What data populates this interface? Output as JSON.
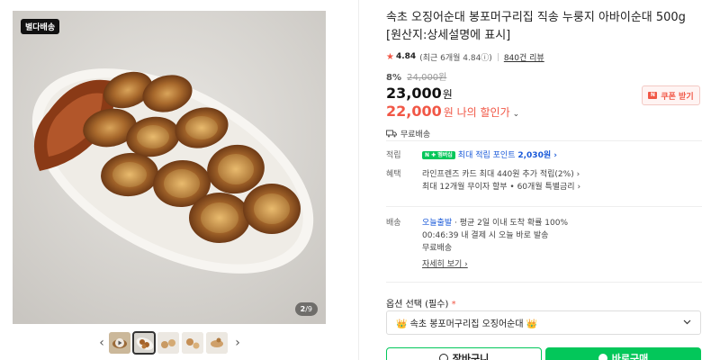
{
  "gallery": {
    "tag": "별다배송",
    "counter_current": "2",
    "counter_sep": "/9",
    "prev_arrow": "‹",
    "next_arrow": "›"
  },
  "product": {
    "title": "속초 오징어순대 봉포머구리집 직송 누룽지 아바이순대 500g [원산지:상세설명에 표시]",
    "rating": "4.84",
    "rating_detail": "(최근 6개월 4.84ⓘ)",
    "reviews": "840건 리뷰",
    "discount_rate": "8%",
    "original_price": "24,000원",
    "price": "23,000",
    "price_unit": "원",
    "my_price": "22,000",
    "my_price_label": "원 나의 할인가",
    "my_price_chevron": "⌄",
    "coupon_label": "쿠폰 받기",
    "shipping_free": "무료배송"
  },
  "benefits": {
    "points_key": "적립",
    "points_badge": "N ✚ 멤버십",
    "points_text": "최대 적립 포인트",
    "points_value": "2,030원 ›",
    "benefit_key": "혜택",
    "benefit_line1": "라인프렌즈 카드 최대 440원 추가 적립(2%) ›",
    "benefit_line2": "최대 12개월 무이자 할부 • 60개월 특별금리 ›"
  },
  "delivery": {
    "key": "배송",
    "today_label": "오늘출발",
    "today_desc": "· 평균 2일 이내 도착 확률 100%",
    "cutoff": "00:46:39  내 결제 시 오늘 바로 발송",
    "fee": "무료배송",
    "detail_link": "자세히 보기 ›"
  },
  "options": {
    "label": "옵션 선택 (필수)",
    "required_mark": "*",
    "selected": "👑 속초 봉포머구리집 오징어순대 👑"
  },
  "actions": {
    "cart_label": "장바구니",
    "buy_label": "바로구매"
  },
  "colors": {
    "accent_red": "#f15746",
    "naver_green": "#03c75a",
    "link_blue": "#1a5ad9"
  }
}
